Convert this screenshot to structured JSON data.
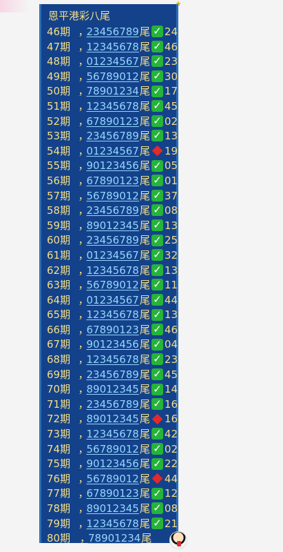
{
  "title": "恩平港彩八尾",
  "rows": [
    {
      "period": "46期",
      "digits": "23456789",
      "tail": "尾",
      "status": "check",
      "value": "24"
    },
    {
      "period": "47期",
      "digits": "12345678",
      "tail": "尾",
      "status": "check",
      "value": "46"
    },
    {
      "period": "48期",
      "digits": "01234567",
      "tail": "尾",
      "status": "check",
      "value": "23"
    },
    {
      "period": "49期",
      "digits": "56789012",
      "tail": "尾",
      "status": "check",
      "value": "30"
    },
    {
      "period": "50期",
      "digits": "78901234",
      "tail": "尾",
      "status": "check",
      "value": "17"
    },
    {
      "period": "51期",
      "digits": "12345678",
      "tail": "尾",
      "status": "check",
      "value": "45"
    },
    {
      "period": "52期",
      "digits": "67890123",
      "tail": "尾",
      "status": "check",
      "value": "02"
    },
    {
      "period": "53期",
      "digits": "23456789",
      "tail": "尾",
      "status": "check",
      "value": "13"
    },
    {
      "period": "54期",
      "digits": "01234567",
      "tail": "尾",
      "status": "diamond",
      "value": "19"
    },
    {
      "period": "55期",
      "digits": "90123456",
      "tail": "尾",
      "status": "check",
      "value": "05"
    },
    {
      "period": "56期",
      "digits": "67890123",
      "tail": "尾",
      "status": "check",
      "value": "01"
    },
    {
      "period": "57期",
      "digits": "56789012",
      "tail": "尾",
      "status": "check",
      "value": "37"
    },
    {
      "period": "58期",
      "digits": "23456789",
      "tail": "尾",
      "status": "check",
      "value": "08"
    },
    {
      "period": "59期",
      "digits": "89012345",
      "tail": "尾",
      "status": "check",
      "value": "13"
    },
    {
      "period": "60期",
      "digits": "23456789",
      "tail": "尾",
      "status": "check",
      "value": "25"
    },
    {
      "period": "61期",
      "digits": "01234567",
      "tail": "尾",
      "status": "check",
      "value": "32"
    },
    {
      "period": "62期",
      "digits": "12345678",
      "tail": "尾",
      "status": "check",
      "value": "13"
    },
    {
      "period": "63期",
      "digits": "56789012",
      "tail": "尾",
      "status": "check",
      "value": "11"
    },
    {
      "period": "64期",
      "digits": "01234567",
      "tail": "尾",
      "status": "check",
      "value": "44"
    },
    {
      "period": "65期",
      "digits": "12345678",
      "tail": "尾",
      "status": "check",
      "value": "13"
    },
    {
      "period": "66期",
      "digits": "67890123",
      "tail": "尾",
      "status": "check",
      "value": "46"
    },
    {
      "period": "67期",
      "digits": "90123456",
      "tail": "尾",
      "status": "check",
      "value": "04"
    },
    {
      "period": "68期",
      "digits": "12345678",
      "tail": "尾",
      "status": "check",
      "value": "23"
    },
    {
      "period": "69期",
      "digits": "23456789",
      "tail": "尾",
      "status": "check",
      "value": "45"
    },
    {
      "period": "70期",
      "digits": "89012345",
      "tail": "尾",
      "status": "check",
      "value": "14"
    },
    {
      "period": "71期",
      "digits": "23456789",
      "tail": "尾",
      "status": "check",
      "value": "16"
    },
    {
      "period": "72期",
      "digits": "89012345",
      "tail": "尾",
      "status": "diamond",
      "value": "16"
    },
    {
      "period": "73期",
      "digits": "12345678",
      "tail": "尾",
      "status": "check",
      "value": "42"
    },
    {
      "period": "74期",
      "digits": "56789012",
      "tail": "尾",
      "status": "check",
      "value": "02"
    },
    {
      "period": "75期",
      "digits": "90123456",
      "tail": "尾",
      "status": "check",
      "value": "22"
    },
    {
      "period": "76期",
      "digits": "56789012",
      "tail": "尾",
      "status": "diamond",
      "value": "44"
    },
    {
      "period": "77期",
      "digits": "67890123",
      "tail": "尾",
      "status": "check",
      "value": "12"
    },
    {
      "period": "78期",
      "digits": "89012345",
      "tail": "尾",
      "status": "check",
      "value": "08"
    },
    {
      "period": "79期",
      "digits": "12345678",
      "tail": "尾",
      "status": "check",
      "value": "21"
    },
    {
      "period": "80期",
      "digits": "78901234",
      "tail": "尾",
      "status": "",
      "value": ""
    }
  ]
}
